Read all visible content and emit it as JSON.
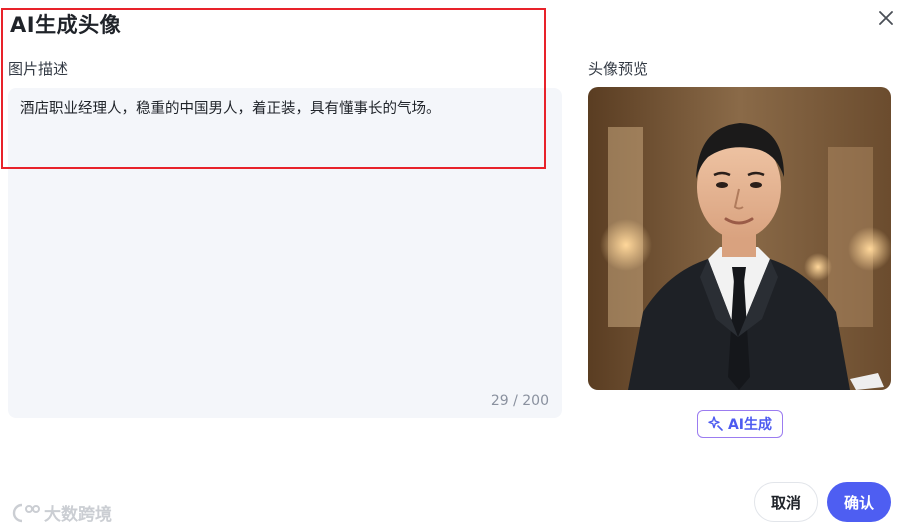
{
  "dialog": {
    "title": "AI生成头像",
    "close_icon": "close-icon"
  },
  "description": {
    "label": "图片描述",
    "value": "酒店职业经理人，稳重的中国男人，着正装，具有懂事长的气场。",
    "counter": "29 / 200"
  },
  "preview": {
    "label": "头像预览",
    "generate_label": "AI生成",
    "generate_icon": "sparkle-icon"
  },
  "footer": {
    "cancel_label": "取消",
    "confirm_label": "确认"
  },
  "watermark": {
    "text": "大数跨境"
  },
  "colors": {
    "primary": "#4e5ef2",
    "highlight": "#e8222a",
    "input_bg": "#f4f6fa"
  }
}
